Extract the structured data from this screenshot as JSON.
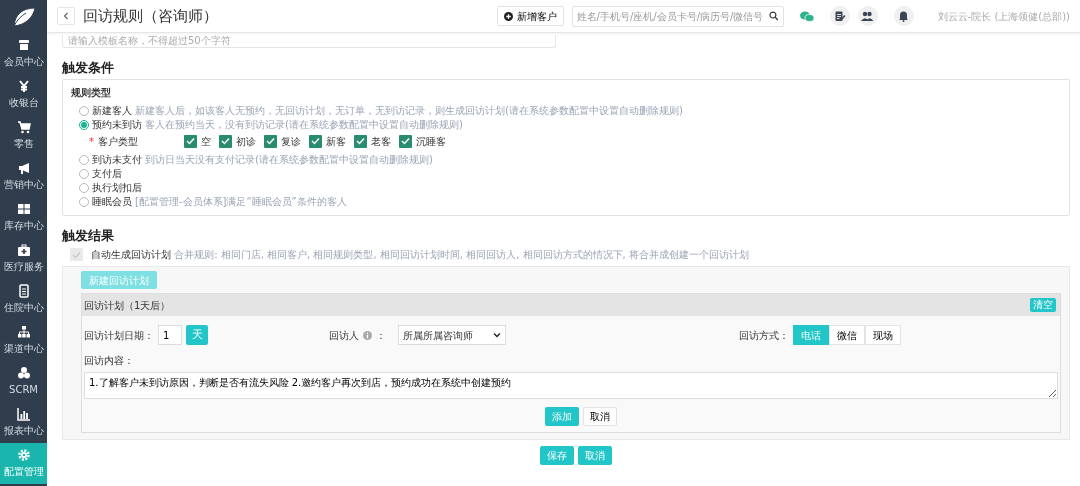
{
  "sidebar": {
    "items": [
      {
        "label": "会员中心",
        "selected": false
      },
      {
        "label": "收银台",
        "selected": false
      },
      {
        "label": "零售",
        "selected": false
      },
      {
        "label": "营销中心",
        "selected": false
      },
      {
        "label": "库存中心",
        "selected": false
      },
      {
        "label": "医疗服务",
        "selected": false
      },
      {
        "label": "住院中心",
        "selected": false
      },
      {
        "label": "渠道中心",
        "selected": false
      },
      {
        "label": "SCRM",
        "selected": false
      },
      {
        "label": "报表中心",
        "selected": false
      },
      {
        "label": "配置管理",
        "selected": true
      }
    ]
  },
  "header": {
    "title": "回访规则（咨询师）",
    "new_customer_button": "新增客户",
    "search": {
      "placeholder": "姓名/手机号/座机/会员卡号/病历号/微信号"
    },
    "user": "刘云云-院长 (上海领健(总部))"
  },
  "template_name": {
    "placeholder": "请输入模板名称，不得超过50个字符"
  },
  "trigger_conditions": {
    "heading": "触发条件",
    "panel_label": "规则类型",
    "rules": [
      {
        "name": "新建客人",
        "description": "新建客人后，如该客人无预约，无回访计划，无订单，无到访记录，则生成回访计划(请在系统参数配置中设置自动删除规则)",
        "selected": false
      },
      {
        "name": "预约未到访",
        "description": "客人在预约当天，没有到访记录(请在系统参数配置中设置自动删除规则)",
        "selected": true,
        "customer_types": {
          "required_mark": "*",
          "label": "客户类型",
          "options": [
            {
              "label": "空",
              "checked": true
            },
            {
              "label": "初诊",
              "checked": true
            },
            {
              "label": "复诊",
              "checked": true
            },
            {
              "label": "新客",
              "checked": true
            },
            {
              "label": "老客",
              "checked": true
            },
            {
              "label": "沉睡客",
              "checked": true
            }
          ]
        }
      },
      {
        "name": "到访未支付",
        "description": "到访日当天没有支付记录(请在系统参数配置中设置自动删除规则)",
        "selected": false
      },
      {
        "name": "支付后",
        "selected": false
      },
      {
        "name": "执行划扣后",
        "selected": false
      },
      {
        "name": "睡眠会员",
        "description": "[配置管理-会员体系]满足“睡眠会员”条件的客人",
        "selected": false
      }
    ]
  },
  "trigger_results": {
    "heading": "触发结果",
    "auto_generate": {
      "label": "自动生成回访计划",
      "hint": "合并规则: 相同门店, 相同客户, 相同规则类型, 相同回访计划时间, 相同回访人, 相同回访方式的情况下, 将合并成创建一个回访计划",
      "checked": true,
      "disabled": true
    },
    "new_plan_button": {
      "label": "新建回访计划",
      "disabled": true
    },
    "plan": {
      "title": "回访计划（1天后）",
      "clear_button": "清空",
      "date_label": "回访计划日期：",
      "date_value": "1",
      "date_unit": "天",
      "visitor_label": "回访人",
      "visitor_colon": "：",
      "visitor_value": "所属所属咨询师",
      "method_label": "回访方式：",
      "methods": [
        {
          "label": "电话",
          "selected": true
        },
        {
          "label": "微信",
          "selected": false
        },
        {
          "label": "现场",
          "selected": false
        }
      ],
      "content_label": "回访内容：",
      "content_value": "1.了解客户未到访原因，判断是否有流失风险 2.邀约客户再次到店，预约成功在系统中创建预约",
      "add_button": "添加",
      "cancel_button": "取消"
    }
  },
  "footer": {
    "save_button": "保存",
    "cancel_button": "取消"
  }
}
